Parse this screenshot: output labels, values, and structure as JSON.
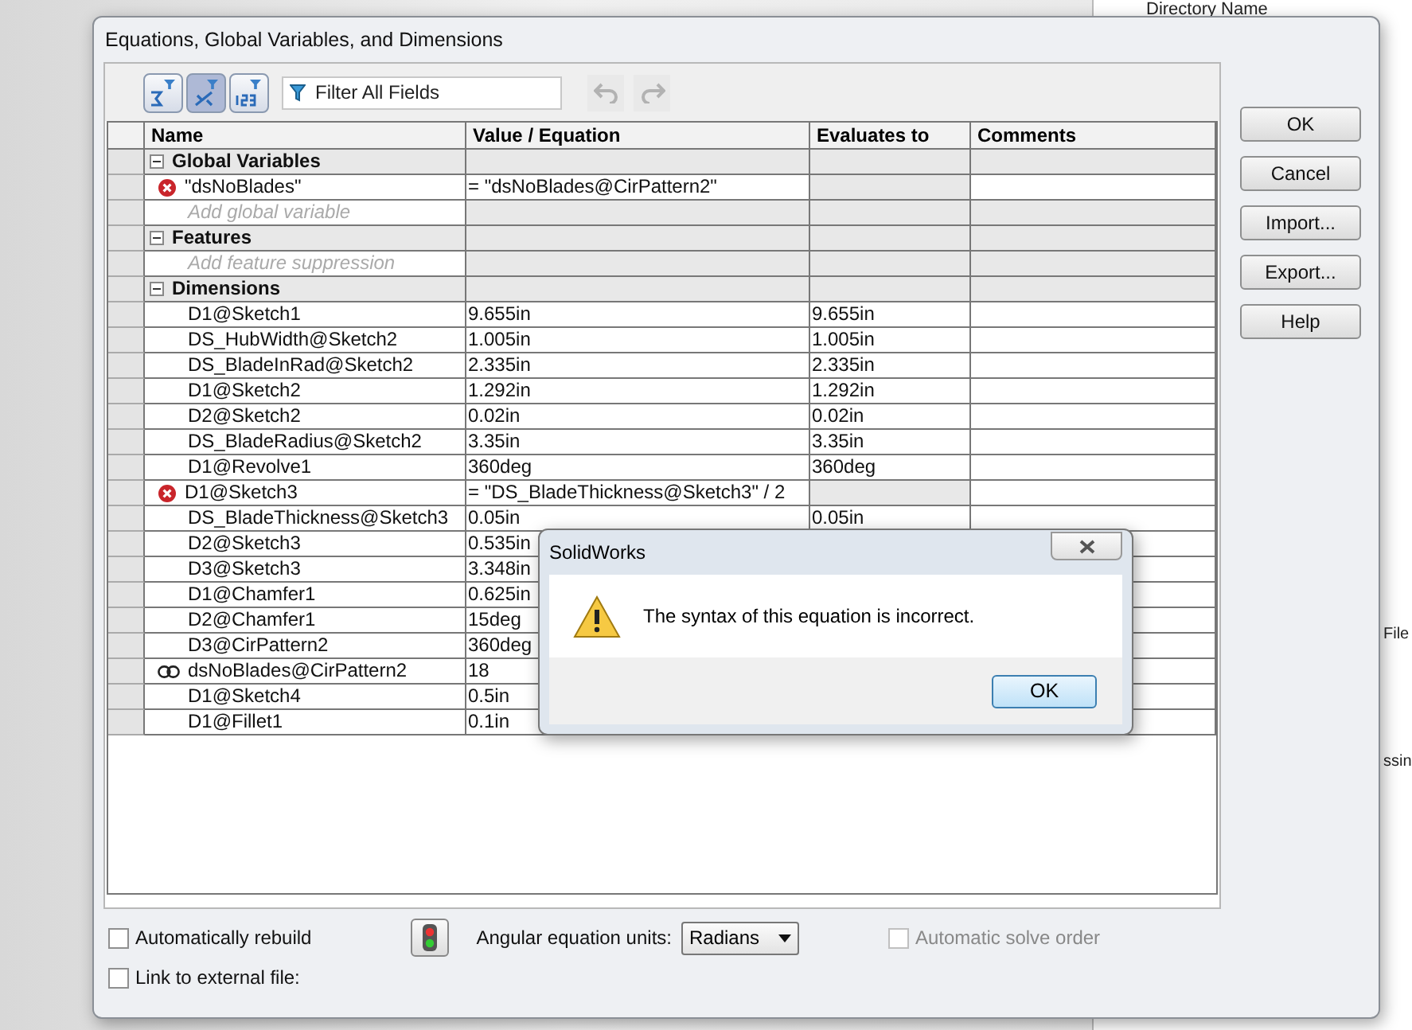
{
  "background": {
    "header": "Directory Name",
    "labels": [
      "File",
      "ssin"
    ]
  },
  "window": {
    "title": "Equations, Global Variables, and Dimensions"
  },
  "toolbar": {
    "views": [
      {
        "selected": false
      },
      {
        "selected": true
      },
      {
        "selected": false
      }
    ],
    "filter": {
      "placeholder": "Filter All Fields"
    },
    "undo": {
      "disabled": true
    },
    "redo": {
      "disabled": true
    }
  },
  "table": {
    "columns": [
      "Name",
      "Value / Equation",
      "Evaluates to",
      "Comments"
    ],
    "rows": [
      {
        "kind": "group",
        "name": "Global Variables",
        "expanded": true
      },
      {
        "kind": "item",
        "error": true,
        "linked": false,
        "name": "\"dsNoBlades\"",
        "value": "= \"dsNoBlades@CirPattern2\""
      },
      {
        "kind": "placeholder",
        "name": "Add global variable"
      },
      {
        "kind": "group",
        "name": "Features",
        "expanded": true
      },
      {
        "kind": "placeholder",
        "name": "Add feature suppression"
      },
      {
        "kind": "group",
        "name": "Dimensions",
        "expanded": true
      },
      {
        "kind": "item",
        "error": false,
        "linked": false,
        "name": "D1@Sketch1",
        "value": "9.655in",
        "result": "9.655in"
      },
      {
        "kind": "item",
        "error": false,
        "linked": false,
        "name": "DS_HubWidth@Sketch2",
        "value": "1.005in",
        "result": "1.005in"
      },
      {
        "kind": "item",
        "error": false,
        "linked": false,
        "name": "DS_BladeInRad@Sketch2",
        "value": "2.335in",
        "result": "2.335in"
      },
      {
        "kind": "item",
        "error": false,
        "linked": false,
        "name": "D1@Sketch2",
        "value": "1.292in",
        "result": "1.292in"
      },
      {
        "kind": "item",
        "error": false,
        "linked": false,
        "name": "D2@Sketch2",
        "value": "0.02in",
        "result": "0.02in"
      },
      {
        "kind": "item",
        "error": false,
        "linked": false,
        "name": "DS_BladeRadius@Sketch2",
        "value": "3.35in",
        "result": "3.35in"
      },
      {
        "kind": "item",
        "error": false,
        "linked": false,
        "name": "D1@Revolve1",
        "value": "360deg",
        "result": "360deg"
      },
      {
        "kind": "item",
        "error": true,
        "linked": false,
        "name": "D1@Sketch3",
        "value": "= \"DS_BladeThickness@Sketch3\" / 2"
      },
      {
        "kind": "item",
        "error": false,
        "linked": false,
        "name": "DS_BladeThickness@Sketch3",
        "value": "0.05in",
        "result": "0.05in"
      },
      {
        "kind": "item",
        "error": false,
        "linked": false,
        "name": "D2@Sketch3",
        "value": "0.535in"
      },
      {
        "kind": "item",
        "error": false,
        "linked": false,
        "name": "D3@Sketch3",
        "value": "3.348in"
      },
      {
        "kind": "item",
        "error": false,
        "linked": false,
        "name": "D1@Chamfer1",
        "value": "0.625in"
      },
      {
        "kind": "item",
        "error": false,
        "linked": false,
        "name": "D2@Chamfer1",
        "value": "15deg"
      },
      {
        "kind": "item",
        "error": false,
        "linked": false,
        "name": "D3@CirPattern2",
        "value": "360deg"
      },
      {
        "kind": "item",
        "error": false,
        "linked": true,
        "name": "dsNoBlades@CirPattern2",
        "value": "18"
      },
      {
        "kind": "item",
        "error": false,
        "linked": false,
        "name": "D1@Sketch4",
        "value": "0.5in"
      },
      {
        "kind": "item",
        "error": false,
        "linked": false,
        "name": "D1@Fillet1",
        "value": "0.1in"
      }
    ]
  },
  "buttons": [
    "OK",
    "Cancel",
    "Import...",
    "Export...",
    "Help"
  ],
  "options": {
    "auto_rebuild": {
      "label": "Automatically rebuild",
      "checked": false
    },
    "angular_units": {
      "label": "Angular equation units:",
      "value": "Radians"
    },
    "auto_solve": {
      "label": "Automatic solve order",
      "checked": false,
      "disabled": true
    },
    "link_file": {
      "label": "Link to external file:",
      "checked": false
    }
  },
  "message_box": {
    "title": "SolidWorks",
    "message": "The syntax of this equation is incorrect.",
    "button": "OK"
  }
}
